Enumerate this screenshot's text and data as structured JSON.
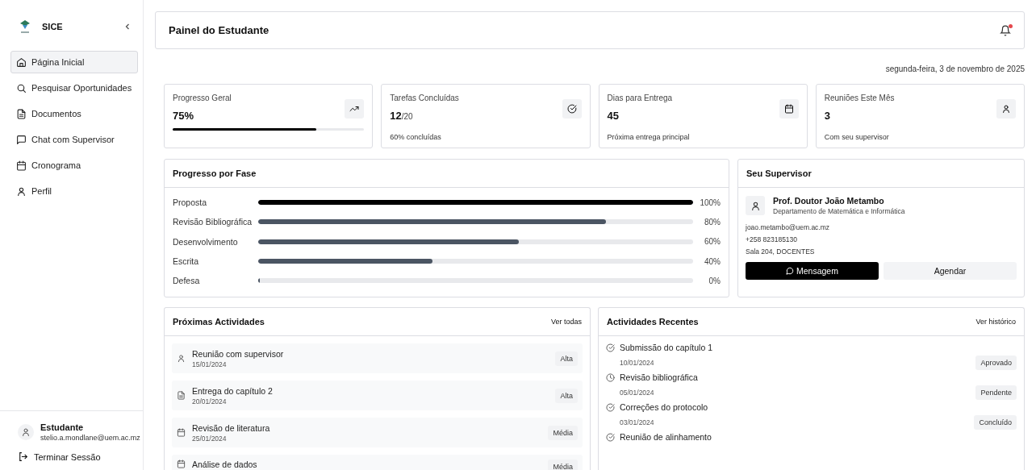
{
  "sidebar": {
    "brand": "SICE",
    "items": [
      {
        "label": "Página Inicial",
        "kind": "home",
        "selected": true
      },
      {
        "label": "Pesquisar Oportunidades",
        "kind": "search",
        "selected": false
      },
      {
        "label": "Documentos",
        "kind": "document",
        "selected": false
      },
      {
        "label": "Chat com Supervisor",
        "kind": "chat",
        "selected": false
      },
      {
        "label": "Cronograma",
        "kind": "calendar",
        "selected": false
      },
      {
        "label": "Perfil",
        "kind": "user",
        "selected": false
      }
    ],
    "user": {
      "name": "Estudante",
      "email": "stelio.a.mondlane@uem.ac.mz"
    },
    "logout": "Terminar Sessão"
  },
  "header": {
    "title": "Painel do Estudante",
    "notifications_unread": true
  },
  "date": "segunda-feira, 3 de novembro de 2025",
  "stats": [
    {
      "label": "Progresso Geral",
      "value": "75%",
      "kind": "trend",
      "level": 0.75
    },
    {
      "label": "Tarefas Concluídas",
      "value": "12",
      "suffix": "/20",
      "kind": "check",
      "note": "60% concluídas"
    },
    {
      "label": "Dias para Entrega",
      "value": "45",
      "kind": "calendar",
      "note": "Próxima entrega principal"
    },
    {
      "label": "Reuniões Este Mês",
      "value": "3",
      "kind": "user",
      "note": "Com seu supervisor"
    }
  ],
  "phases": {
    "title": "Progresso por Fase",
    "items": [
      {
        "name": "Proposta",
        "level": 1,
        "reading": "100%"
      },
      {
        "name": "Revisão Bibliográfica",
        "level": 0.8,
        "reading": "80%"
      },
      {
        "name": "Desenvolvimento",
        "level": 0.6,
        "reading": "60%"
      },
      {
        "name": "Escrita",
        "level": 0.4,
        "reading": "40%"
      },
      {
        "name": "Defesa",
        "level": 0,
        "reading": "0%"
      }
    ]
  },
  "supervisor": {
    "title": "Seu Supervisor",
    "name": "Prof. Doutor João Metambo",
    "department": "Departamento de Matemática e Informática",
    "email": "joao.metambo@uem.ac.mz",
    "phone": "+258 823185130",
    "office": "Sala 204, DOCENTES",
    "buttons": [
      "Mensagem",
      "Agendar"
    ]
  },
  "upcoming": {
    "title": "Próximas Actividades",
    "link": "Ver todas",
    "items": [
      {
        "title": "Reunião com supervisor",
        "date": "15/01/2024",
        "kind": "user",
        "priority": "Alta"
      },
      {
        "title": "Entrega do capítulo 2",
        "date": "20/01/2024",
        "kind": "document",
        "priority": "Alta"
      },
      {
        "title": "Revisão de literatura",
        "date": "25/01/2024",
        "kind": "calendar",
        "priority": "Média"
      },
      {
        "title": "Análise de dados",
        "kind": "calendar",
        "priority": "Média"
      }
    ]
  },
  "recent": {
    "title": "Actividades Recentes",
    "link": "Ver histórico",
    "items": [
      {
        "title": "Submissão do capítulo 1",
        "date": "10/01/2024",
        "kind": "check",
        "status": "Aprovado"
      },
      {
        "title": "Revisão bibliográfica",
        "date": "05/01/2024",
        "kind": "clock",
        "status": "Pendente"
      },
      {
        "title": "Correções do protocolo",
        "date": "03/01/2024",
        "kind": "check",
        "status": "Concluído"
      },
      {
        "title": "Reunião de alinhamento",
        "kind": "check"
      }
    ]
  }
}
